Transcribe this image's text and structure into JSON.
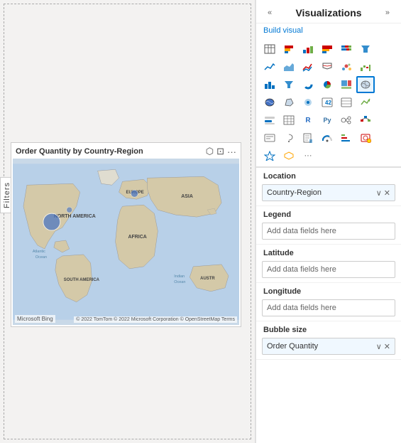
{
  "panel": {
    "title": "Visualizations",
    "build_visual": "Build visual",
    "collapse_left": "«",
    "expand_right": "»"
  },
  "filters": {
    "label": "Filters"
  },
  "visual": {
    "title": "Order Quantity by Country-Region",
    "bing_logo": "Microsoft Bing",
    "copyright": "© 2022 TomTom © 2022 Microsoft Corporation © OpenStreetMap   Terms"
  },
  "viz_icons": [
    {
      "id": "table",
      "symbol": "⊞",
      "active": false
    },
    {
      "id": "bar-chart",
      "symbol": "▦",
      "active": false
    },
    {
      "id": "stacked-bar",
      "symbol": "▤",
      "active": false
    },
    {
      "id": "clustered-bar",
      "symbol": "▥",
      "active": false
    },
    {
      "id": "stacked-bar-100",
      "symbol": "▧",
      "active": false
    },
    {
      "id": "funnel",
      "symbol": "≡",
      "active": false
    },
    {
      "id": "line",
      "symbol": "∿",
      "active": false
    },
    {
      "id": "area",
      "symbol": "△",
      "active": false
    },
    {
      "id": "line-stacked",
      "symbol": "⋀",
      "active": false
    },
    {
      "id": "ribbon",
      "symbol": "⋯",
      "active": false
    },
    {
      "id": "scatter",
      "symbol": "⋰",
      "active": false
    },
    {
      "id": "waterfall",
      "symbol": "↕",
      "active": false
    },
    {
      "id": "column",
      "symbol": "∥",
      "active": false
    },
    {
      "id": "donut",
      "symbol": "◎",
      "active": false
    },
    {
      "id": "pie",
      "symbol": "◑",
      "active": false
    },
    {
      "id": "treemap",
      "symbol": "⊡",
      "active": false
    },
    {
      "id": "map",
      "symbol": "🌍",
      "active": true
    },
    {
      "id": "filled-map",
      "symbol": "🗺",
      "active": false
    },
    {
      "id": "shape-map",
      "symbol": "〰",
      "active": false
    },
    {
      "id": "number",
      "symbol": "①",
      "active": false
    },
    {
      "id": "multi-row",
      "symbol": "⊟",
      "active": false
    },
    {
      "id": "kpi",
      "symbol": "▲",
      "active": false
    },
    {
      "id": "slicer",
      "symbol": "⊠",
      "active": false
    },
    {
      "id": "matrix",
      "symbol": "⊞",
      "active": false
    },
    {
      "id": "r-visual",
      "symbol": "R",
      "active": false
    },
    {
      "id": "python",
      "symbol": "Py",
      "active": false
    },
    {
      "id": "key-influencers",
      "symbol": "⤴",
      "active": false
    },
    {
      "id": "table2",
      "symbol": "⊟",
      "active": false
    },
    {
      "id": "gauge",
      "symbol": "◕",
      "active": false
    },
    {
      "id": "decomp",
      "symbol": "⊕",
      "active": false
    },
    {
      "id": "more1",
      "symbol": "◈",
      "active": false
    },
    {
      "id": "more2",
      "symbol": "⬡",
      "active": false
    },
    {
      "id": "ellipsis",
      "symbol": "···",
      "active": false
    }
  ],
  "field_sections": [
    {
      "id": "location",
      "label": "Location",
      "slots": [
        {
          "filled": true,
          "text": "Country-Region",
          "has_dropdown": true,
          "has_close": true
        }
      ]
    },
    {
      "id": "legend",
      "label": "Legend",
      "slots": [
        {
          "filled": false,
          "text": "Add data fields here",
          "has_dropdown": false,
          "has_close": false
        }
      ]
    },
    {
      "id": "latitude",
      "label": "Latitude",
      "slots": [
        {
          "filled": false,
          "text": "Add data fields here",
          "has_dropdown": false,
          "has_close": false
        }
      ]
    },
    {
      "id": "longitude",
      "label": "Longitude",
      "slots": [
        {
          "filled": false,
          "text": "Add data fields here",
          "has_dropdown": false,
          "has_close": false
        }
      ]
    },
    {
      "id": "bubble-size",
      "label": "Bubble size",
      "slots": [
        {
          "filled": true,
          "text": "Order Quantity",
          "has_dropdown": true,
          "has_close": true
        }
      ]
    }
  ]
}
